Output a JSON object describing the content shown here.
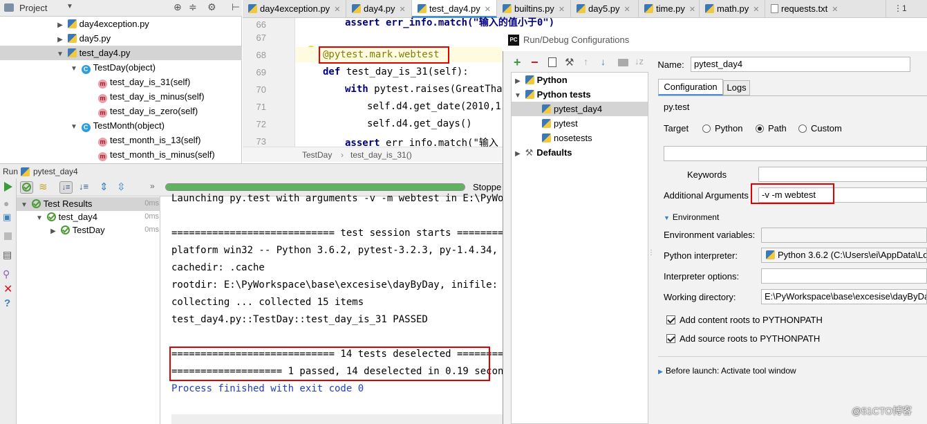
{
  "project": {
    "header": "Project",
    "items": [
      {
        "label": "day4exception.py",
        "type": "file"
      },
      {
        "label": "day5.py",
        "type": "file"
      },
      {
        "label": "test_day4.py",
        "type": "file"
      },
      {
        "label": "TestDay(object)",
        "type": "class"
      },
      {
        "label": "test_day_is_31(self)",
        "type": "method"
      },
      {
        "label": "test_day_is_minus(self)",
        "type": "method"
      },
      {
        "label": "test_day_is_zero(self)",
        "type": "method"
      },
      {
        "label": "TestMonth(object)",
        "type": "class"
      },
      {
        "label": "test_month_is_13(self)",
        "type": "method"
      },
      {
        "label": "test_month_is_minus(self)",
        "type": "method"
      }
    ]
  },
  "tabs": [
    "day4exception.py",
    "day4.py",
    "test_day4.py",
    "builtins.py",
    "day5.py",
    "time.py",
    "math.py",
    "requests.txt"
  ],
  "tabs_more": "⋮1",
  "editor": {
    "line_numbers": [
      "66",
      "67",
      "68",
      "69",
      "70",
      "71",
      "72",
      "73"
    ],
    "lines": {
      "l66": "assert err_info.match(\"输入的值小于0\")",
      "l68": "@pytest.mark.webtest",
      "l69_kw": "def",
      "l69": " test_day_is_31(self):",
      "l70_kw": "with",
      "l70": " pytest.raises(GreatThan",
      "l71": "self.d4.get_date(2010,1,3",
      "l72": "self.d4.get_days()",
      "l73_kw": "assert",
      "l73": " err_info.match(\"输入"
    },
    "breadcrumb": [
      "TestDay",
      "test_day_is_31()"
    ]
  },
  "run": {
    "label": "Run",
    "config": "pytest_day4",
    "status": "Stoppe",
    "tree": [
      {
        "label": "Test Results",
        "time": "0ms"
      },
      {
        "label": "test_day4",
        "time": "0ms"
      },
      {
        "label": "TestDay",
        "time": "0ms"
      }
    ],
    "console": [
      "Launching py.test with arguments -v -m webtest in E:\\PyWorks",
      "",
      "============================ test session starts =========",
      "platform win32 -- Python 3.6.2, pytest-3.2.3, py-1.4.34, plu",
      "cachedir: .cache",
      "rootdir: E:\\PyWorkspace\\base\\excesise\\dayByDay, inifile:",
      "collecting ... collected 15 items",
      "test_day4.py::TestDay::test_day_is_31 PASSED",
      "",
      "============================ 14 tests deselected ==========",
      "=================== 1 passed, 14 deselected in 0.19 seconds",
      "Process finished with exit code 0"
    ]
  },
  "dialog": {
    "title": "Run/Debug Configurations",
    "tree": [
      {
        "label": "Python"
      },
      {
        "label": "Python tests"
      },
      {
        "label": "pytest_day4"
      },
      {
        "label": "pytest"
      },
      {
        "label": "nosetests"
      },
      {
        "label": "Defaults"
      }
    ],
    "name_label": "Name:",
    "name_value": "pytest_day4",
    "tab_configuration": "Configuration",
    "tab_logs": "Logs",
    "runner": "py.test",
    "target_label": "Target",
    "target_options": [
      "Python",
      "Path",
      "Custom"
    ],
    "keywords_label": "Keywords",
    "additional_label": "Additional Arguments",
    "additional_value": "-v -m webtest",
    "environment_label": "Environment",
    "env_vars_label": "Environment variables:",
    "interpreter_label": "Python interpreter:",
    "interpreter_value": "Python 3.6.2 (C:\\Users\\ei\\AppData\\Lo",
    "interp_options_label": "Interpreter options:",
    "workdir_label": "Working directory:",
    "workdir_value": "E:\\PyWorkspace\\base\\excesise\\dayByDa",
    "content_roots": "Add content roots to PYTHONPATH",
    "source_roots": "Add source roots to PYTHONPATH",
    "before_launch": "Before launch: Activate tool window"
  },
  "watermark": "@51CTO博客"
}
